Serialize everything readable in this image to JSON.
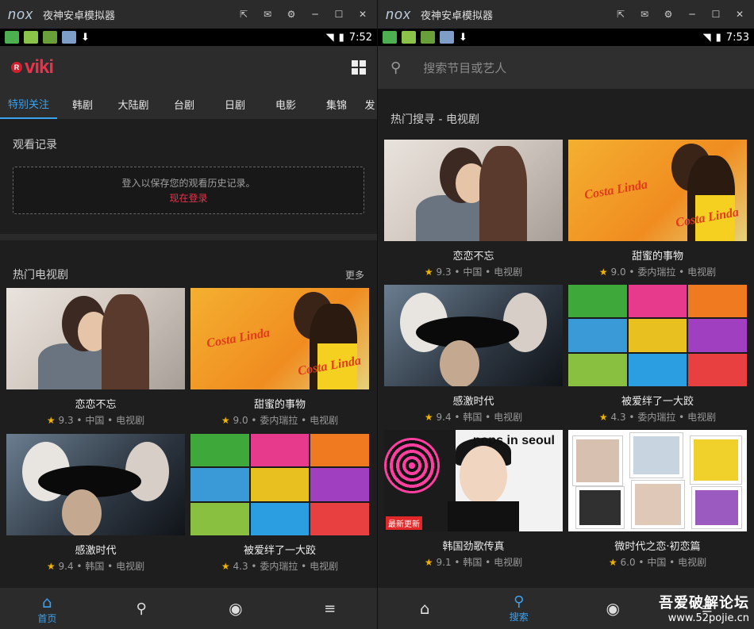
{
  "left": {
    "window_title": "夜神安卓模拟器",
    "nox": "nox",
    "status_time": "7:52",
    "logo": "viki",
    "tabs": [
      "特别关注",
      "韩剧",
      "大陆剧",
      "台剧",
      "日剧",
      "电影",
      "集锦",
      "发"
    ],
    "history_title": "观看记录",
    "login_hint": "登入以保存您的观看历史记录。",
    "login_link": "现在登录",
    "popular_title": "热门电视剧",
    "more": "更多",
    "cards": [
      {
        "title": "恋恋不忘",
        "rating": "9.3",
        "country": "中国",
        "type": "电视剧"
      },
      {
        "title": "甜蜜的事物",
        "rating": "9.0",
        "country": "委内瑞拉",
        "type": "电视剧"
      },
      {
        "title": "感激时代",
        "rating": "9.4",
        "country": "韩国",
        "type": "电视剧"
      },
      {
        "title": "被爱绊了一大跤",
        "rating": "4.3",
        "country": "委内瑞拉",
        "type": "电视剧"
      }
    ],
    "nav": {
      "home": "首页"
    }
  },
  "right": {
    "window_title": "夜神安卓模拟器",
    "nox": "nox",
    "status_time": "7:53",
    "search_placeholder": "搜索节目或艺人",
    "hot_title": "热门搜寻 - 电视剧",
    "cards": [
      {
        "title": "恋恋不忘",
        "rating": "9.3",
        "country": "中国",
        "type": "电视剧"
      },
      {
        "title": "甜蜜的事物",
        "rating": "9.0",
        "country": "委内瑞拉",
        "type": "电视剧"
      },
      {
        "title": "感激时代",
        "rating": "9.4",
        "country": "韩国",
        "type": "电视剧"
      },
      {
        "title": "被爱绊了一大跤",
        "rating": "4.3",
        "country": "委内瑞拉",
        "type": "电视剧"
      },
      {
        "title": "韩国劲歌传真",
        "rating": "9.1",
        "country": "韩国",
        "type": "电视剧"
      },
      {
        "title": "微时代之恋·初恋篇",
        "rating": "6.0",
        "country": "中国",
        "type": "电视剧"
      }
    ],
    "nav": {
      "search": "搜索"
    },
    "thumb_text": {
      "costa_logo": "Costa Linda",
      "pop_logo": "pops in seoul",
      "pop_tag": "最新更新"
    }
  },
  "watermark": {
    "cn": "吾爱破解论坛",
    "url": "www.52pojie.cn"
  },
  "colors": {
    "accent_blue": "#3da2ee",
    "viki_red": "#e8334a",
    "star": "#f0b400"
  }
}
